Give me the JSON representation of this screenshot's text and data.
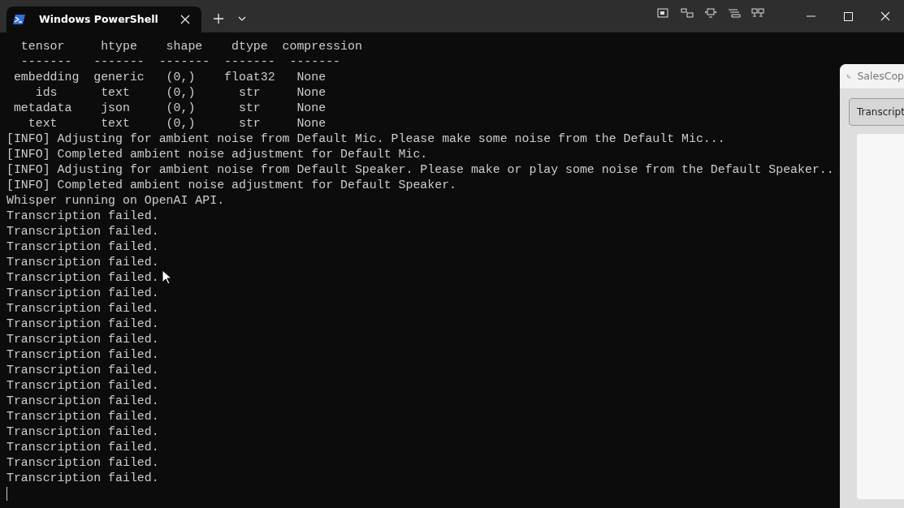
{
  "window": {
    "tab_title": "Windows PowerShell"
  },
  "terminal": {
    "lines": [
      "  tensor     htype    shape    dtype  compression",
      "  -------   -------  -------  -------  -------",
      " embedding  generic   (0,)    float32   None",
      "    ids      text     (0,)      str     None",
      " metadata    json     (0,)      str     None",
      "   text      text     (0,)      str     None",
      "[INFO] Adjusting for ambient noise from Default Mic. Please make some noise from the Default Mic...",
      "[INFO] Completed ambient noise adjustment for Default Mic.",
      "[INFO] Adjusting for ambient noise from Default Speaker. Please make or play some noise from the Default Speaker..",
      "[INFO] Completed ambient noise adjustment for Default Speaker.",
      "Whisper running on OpenAI API.",
      "Transcription failed.",
      "Transcription failed.",
      "Transcription failed.",
      "Transcription failed.",
      "Transcription failed.",
      "Transcription failed.",
      "Transcription failed.",
      "Transcription failed.",
      "Transcription failed.",
      "Transcription failed.",
      "Transcription failed.",
      "Transcription failed.",
      "Transcription failed.",
      "Transcription failed.",
      "Transcription failed.",
      "Transcription failed.",
      "Transcription failed.",
      "Transcription failed."
    ]
  },
  "side_window": {
    "title": "SalesCop",
    "button": "Transcript"
  }
}
